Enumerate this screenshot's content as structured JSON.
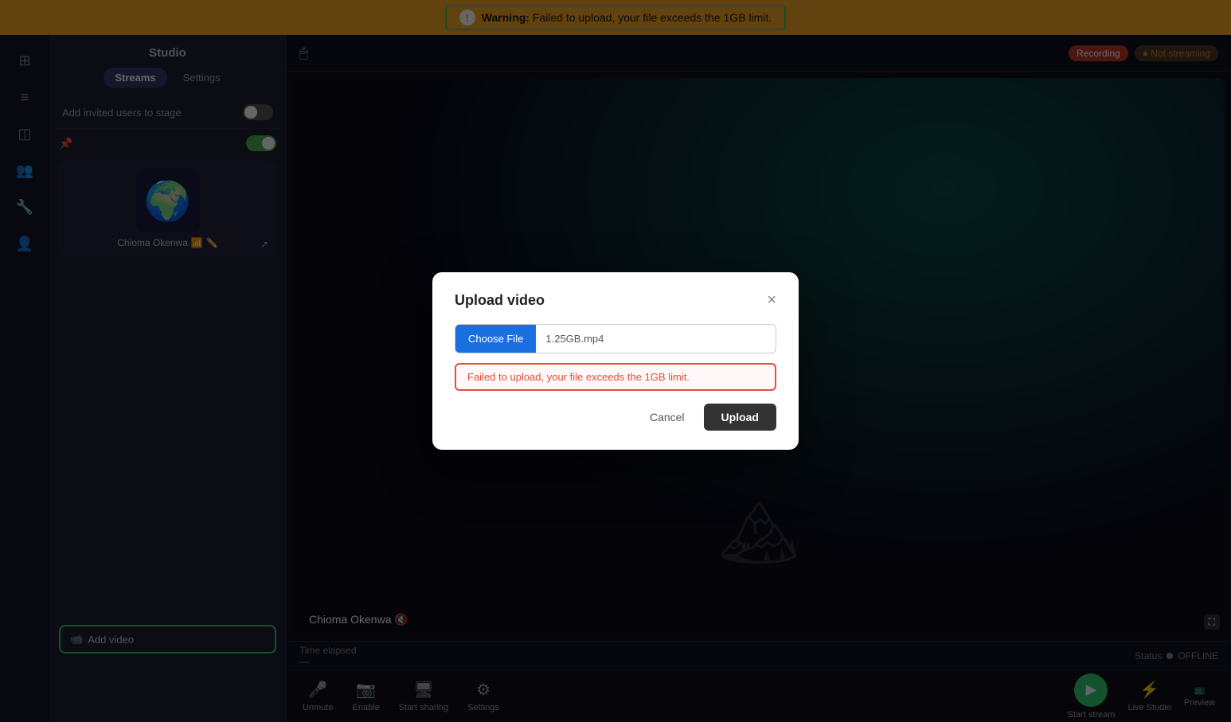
{
  "warning": {
    "text_bold": "Warning:",
    "text_rest": " Failed to upload, your file exceeds the 1GB limit."
  },
  "sidebar": {
    "icons": [
      "⊞",
      "☰",
      "◫",
      "👥",
      "🔧",
      "👤"
    ]
  },
  "studio": {
    "title": "Studio",
    "tabs": [
      {
        "label": "Streams",
        "active": true
      },
      {
        "label": "Settings",
        "active": false
      }
    ],
    "invite_label": "Add invited users to stage",
    "participant_name": "Chioma Okenwa",
    "participant_emoji": "🌍",
    "add_video_label": "Add video"
  },
  "topbar": {
    "recording_label": "Recording",
    "not_streaming_label": "● Not streaming"
  },
  "canvas": {
    "user_name": "Chioma Okenwa 🔇"
  },
  "status_bar": {
    "time_elapsed_label": "Time elapsed",
    "time_value": "—",
    "status_label": "Status",
    "status_value": "OFFLINE"
  },
  "toolbar": {
    "unmute_label": "Unmute",
    "enable_label": "Enable",
    "start_sharing_label": "Start sharing",
    "settings_label": "Settings",
    "start_stream_label": "Start stream",
    "live_studio_label": "Live Studio",
    "preview_label": "Preview"
  },
  "dialog": {
    "title": "Upload video",
    "choose_file_label": "Choose File",
    "file_name": "1.25GB.mp4",
    "error_message": "Failed to upload, your file exceeds the 1GB limit.",
    "cancel_label": "Cancel",
    "upload_label": "Upload"
  }
}
